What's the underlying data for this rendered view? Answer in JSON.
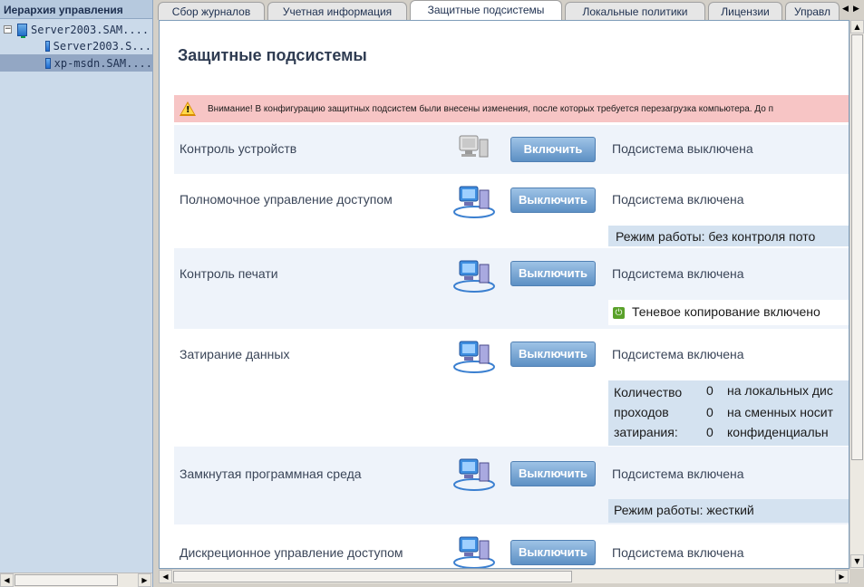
{
  "left_pane": {
    "header": "Иерархия управления",
    "tree": [
      {
        "label": "Server2003.SAM....",
        "expander": "−",
        "level": 0,
        "selected": false,
        "icon": "server-icon"
      },
      {
        "label": "Server2003.S...",
        "level": 1,
        "selected": false,
        "icon": "computer-icon"
      },
      {
        "label": "xp-msdn.SAM....",
        "level": 1,
        "selected": true,
        "icon": "computer-icon"
      }
    ]
  },
  "tabs": [
    {
      "label": "Сбор журналов",
      "active": false
    },
    {
      "label": "Учетная информация",
      "active": false
    },
    {
      "label": "Защитные подсистемы",
      "active": true
    },
    {
      "label": "Локальные политики",
      "active": false
    },
    {
      "label": "Лицензии",
      "active": false
    },
    {
      "label": "Управл",
      "active": false
    }
  ],
  "page": {
    "title": "Защитные подсистемы",
    "warning": "Внимание! В конфигурацию защитных подсистем были внесены изменения, после которых требуется перезагрузка компьютера. До п"
  },
  "subsystems": [
    {
      "name": "Контроль устройств",
      "button": "Включить",
      "status": "Подсистема выключена",
      "enabled": false
    },
    {
      "name": "Полномочное управление доступом",
      "button": "Выключить",
      "status": "Подсистема включена",
      "enabled": true,
      "detail": "Режим работы: без контроля пото"
    },
    {
      "name": "Контроль печати",
      "button": "Выключить",
      "status": "Подсистема включена",
      "enabled": true,
      "detail": "Теневое копирование включено"
    },
    {
      "name": "Затирание данных",
      "button": "Выключить",
      "status": "Подсистема включена",
      "enabled": true,
      "wipe": {
        "label": "Количество проходов затирания:",
        "label_lines": [
          "Количество",
          "проходов",
          "затирания:"
        ],
        "values": [
          "0",
          "0",
          "0"
        ],
        "targets": [
          "на локальных дис",
          "на сменных носит",
          "конфиденциальн"
        ]
      }
    },
    {
      "name": "Замкнутая программная среда",
      "button": "Выключить",
      "status": "Подсистема включена",
      "enabled": true,
      "detail": "Режим работы: жесткий"
    },
    {
      "name": "Дискреционное управление доступом",
      "button": "Выключить",
      "status": "Подсистема включена",
      "enabled": true
    }
  ],
  "colors": {
    "warning_bg": "#f7c5c5",
    "row_shade": "#eef3fa",
    "detail_bg": "#d4e2f0",
    "button": "#6f9fd0",
    "left_pane": "#cbdaea"
  }
}
